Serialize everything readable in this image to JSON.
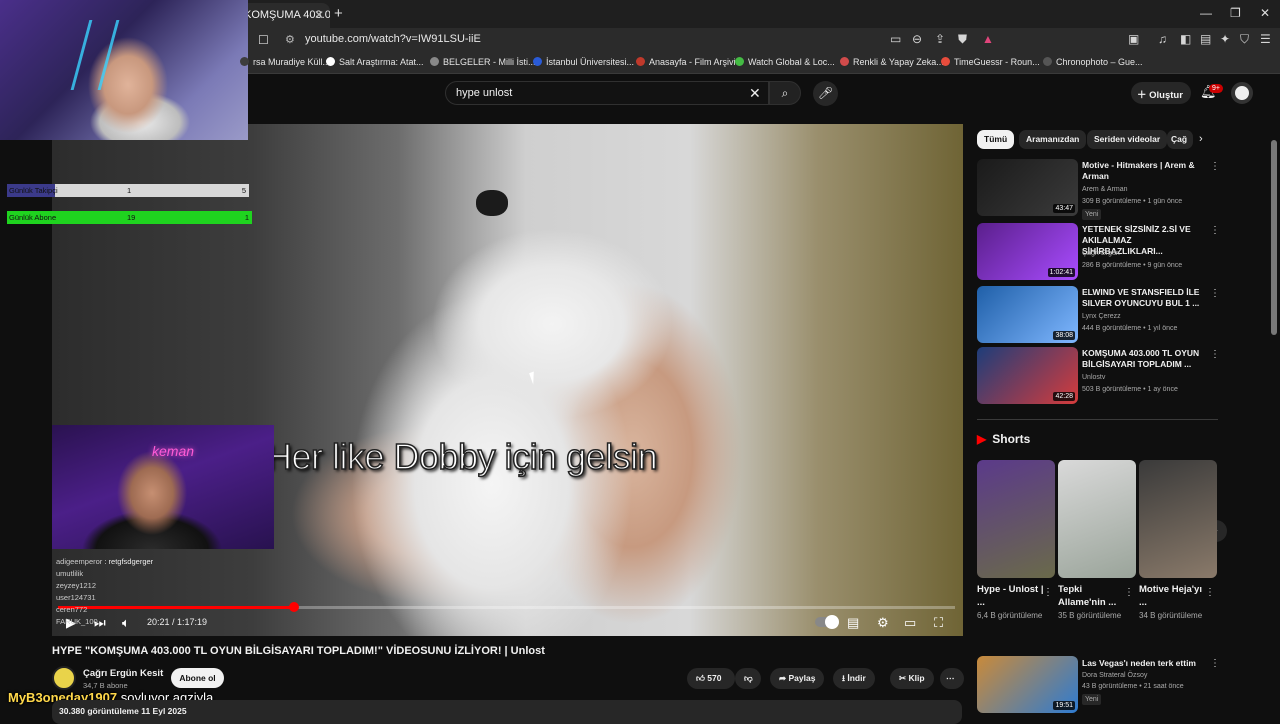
{
  "browser": {
    "tab_title": "KOMŞUMA 403.0(",
    "tab_close": "✕",
    "new_tab": "+",
    "window_buttons": [
      "—",
      "❐",
      "✕"
    ],
    "url": "youtube.com/watch?v=IW91LSU-iiE",
    "bookmarks": [
      {
        "label": "rsa Muradiye Küll...",
        "color": "#3d3d3d"
      },
      {
        "label": "Salt Araştırma: Atat...",
        "color": "#ffffff"
      },
      {
        "label": "BELGELER - Milli İsti...",
        "color": "#888888"
      },
      {
        "label": "İstanbul Üniversitesi...",
        "color": "#2a5bd7"
      },
      {
        "label": "Anasayfa - Film Arşivi",
        "color": "#c0392b"
      },
      {
        "label": "Watch Global & Loc...",
        "color": "#44bb44"
      },
      {
        "label": "Renkli & Yapay Zeka...",
        "color": "#d14b4b"
      },
      {
        "label": "TimeGuessr - Roun...",
        "color": "#e74c3c"
      },
      {
        "label": "Chronophoto – Gue...",
        "color": "#555555"
      }
    ]
  },
  "header": {
    "search_value": "hype unlost",
    "create_label": "Oluştur",
    "notification_badge": "9+"
  },
  "video": {
    "subtitle": "Her like Dobby için gelsin",
    "time": "20:21 / 1:17:19",
    "progress_fraction": 0.263,
    "title": "HYPE \"KOMŞUMA 403.000 TL OYUN BİLGİSAYARI TOPLADIM!\" VİDEOSUNU İZLİYOR! | Unlost",
    "channel_name": "Çağrı Ergün Kesit",
    "channel_subs": "34,7 B abone",
    "subscribe_label": "Abone ol",
    "like_count": "570",
    "share_label": "Paylaş",
    "download_label": "İndir",
    "clip_label": "Klip",
    "description_meta": "30.380 görüntüleme  11 Eyl 2025"
  },
  "overlay": {
    "bar1": {
      "label": "Günlük Takipçi",
      "value1": "1",
      "value2": "5",
      "fill_fraction": 0.2
    },
    "bar2": {
      "label": "Günlük Abone",
      "value1": "19",
      "value2": "1"
    },
    "cam2_sign": "keman",
    "chat": [
      {
        "user": "adigeemperor",
        "text": "retgfsdgerger"
      },
      {
        "user": "umutlilik",
        "text": ""
      },
      {
        "user": "zeyzey1212",
        "text": ""
      },
      {
        "user": "user124731",
        "text": ""
      },
      {
        "user": "ceren772",
        "text": ""
      },
      {
        "user": "FARUK_100",
        "text": ""
      }
    ],
    "tts_user": "MyB3oneday1907",
    "tts_text": "soyluyor agziyla"
  },
  "sidebar": {
    "chips": [
      "Tümü",
      "Aramanızdan",
      "Seriden videolar",
      "Çağ"
    ],
    "recommendations": [
      {
        "title": "Motive - Hitmakers | Arem & Arman",
        "channel": "Arem & Arman",
        "meta": "309 B görüntüleme • 1 gün önce",
        "duration": "43:47",
        "badge": "Yeni",
        "colors": [
          "#1a1a1a",
          "#3b3b3b"
        ]
      },
      {
        "title": "YETENEK SİZSİNİZ 2.Sİ VE AKILALMAZ SİHİRBAZLIKLARI...",
        "channel": "Çağrı Ergün",
        "meta": "286 B görüntüleme • 9 gün önce",
        "duration": "1:02:41",
        "badge": "",
        "colors": [
          "#5a1f8c",
          "#a94cff"
        ]
      },
      {
        "title": "ELWIND VE STANSFIELD İLE SILVER OYUNCUYU BUL 1 ...",
        "channel": "Lynx Çerezz",
        "meta": "444 B görüntüleme • 1 yıl önce",
        "duration": "38:08",
        "badge": "",
        "colors": [
          "#1f5fa8",
          "#7fb7ff"
        ]
      },
      {
        "title": "KOMŞUMA 403.000 TL OYUN BİLGİSAYARI TOPLADIM ...",
        "channel": "Unlostv",
        "meta": "503 B görüntüleme • 1 ay önce",
        "duration": "42:28",
        "badge": "",
        "colors": [
          "#1d3d7a",
          "#d63c3c"
        ]
      }
    ],
    "shorts_title": "Shorts",
    "shorts": [
      {
        "title": "Hype - Unlost | ...",
        "views": "6,4 B görüntüleme",
        "colors": [
          "#5b3a8a",
          "#6a6a4a"
        ]
      },
      {
        "title": "Tepki Allame'nin ...",
        "views": "35 B görüntüleme",
        "colors": [
          "#d9d9d9",
          "#9aa49a"
        ]
      },
      {
        "title": "Motive Heja'yı ...",
        "views": "34 B görüntüleme",
        "colors": [
          "#3a3a3a",
          "#8a7a6a"
        ]
      }
    ],
    "bottom_rec": {
      "title": "Las Vegas'ı neden terk ettim",
      "channel": "Dora Strateral Özsoy",
      "meta": "43 B görüntüleme • 21 saat önce",
      "duration": "19:51",
      "badge": "Yeni"
    }
  }
}
